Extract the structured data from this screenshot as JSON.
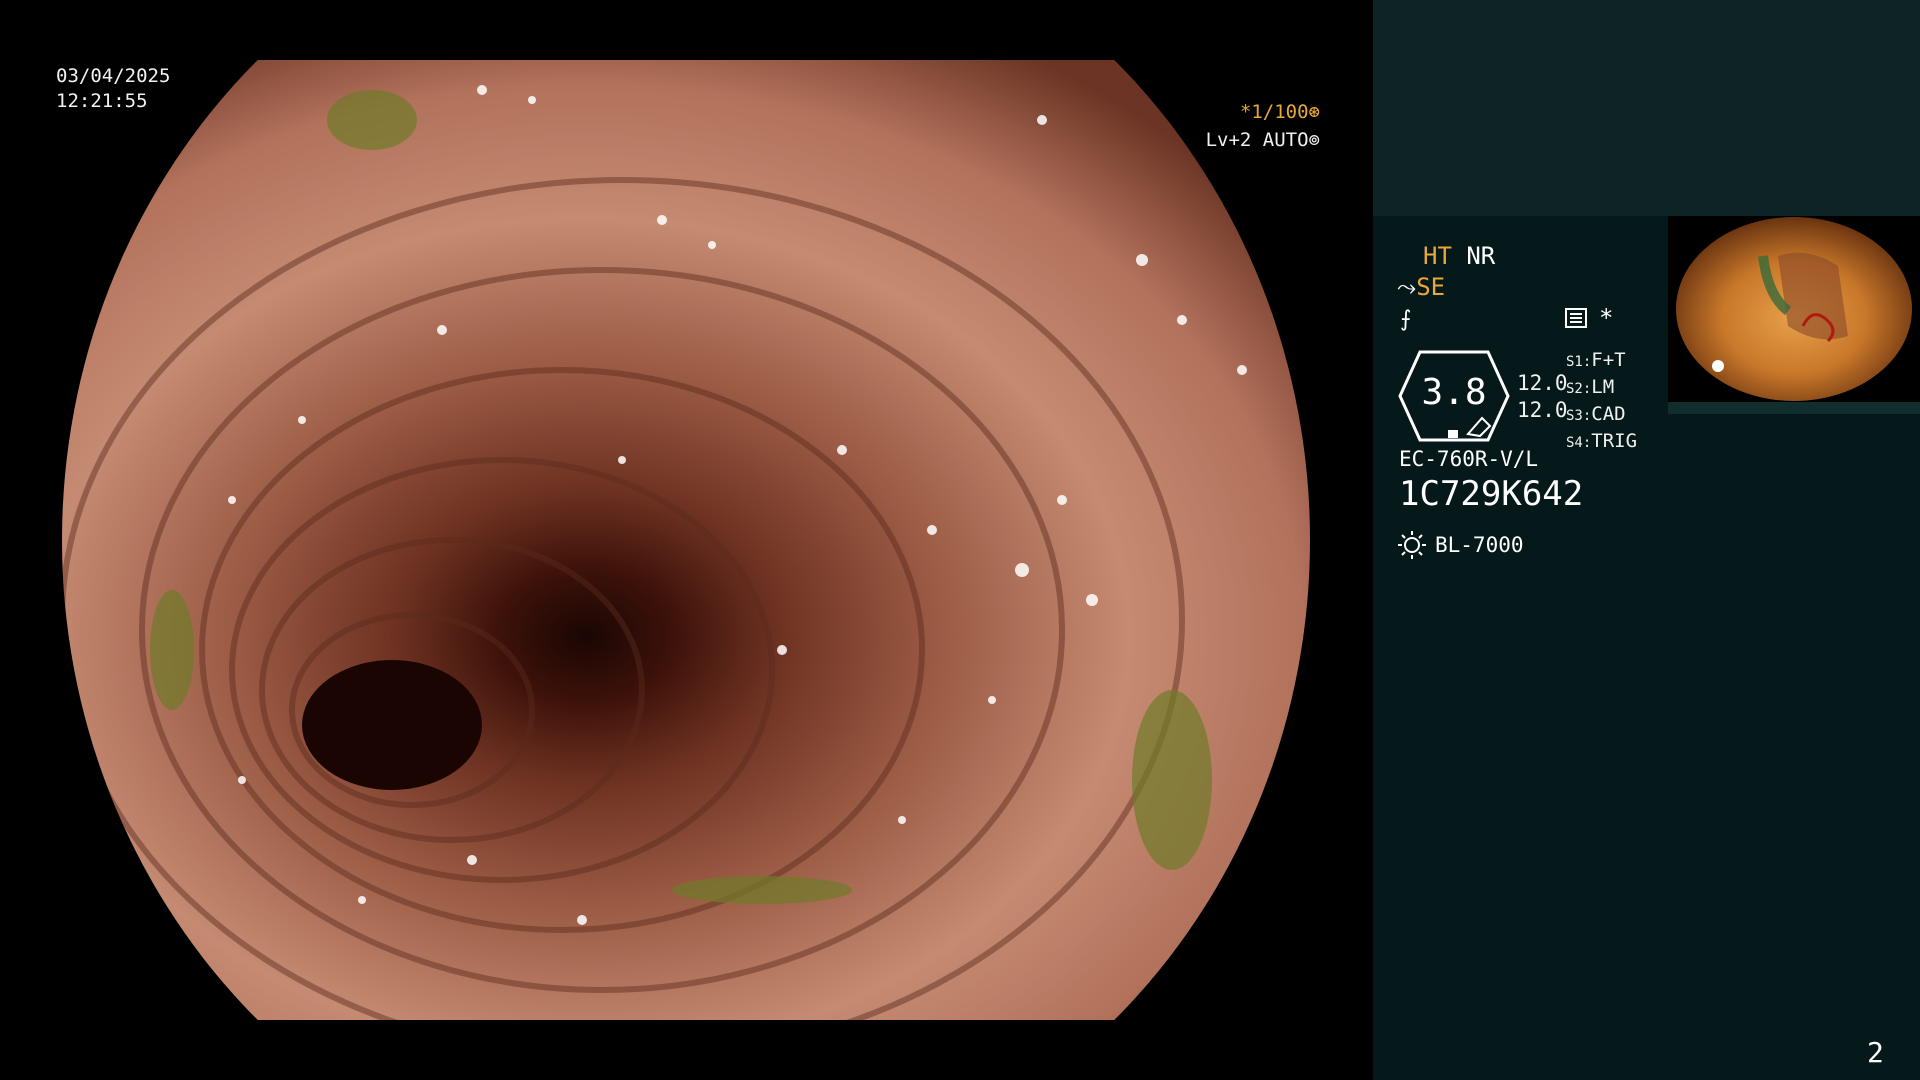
{
  "screen": {
    "date": "03/04/2025",
    "time": "12:21:55",
    "shutter_speed": "*1/100",
    "shutter_speed_icon": "aperture-icon",
    "light_level": "Lv+2 AUTO",
    "light_level_icon": "iris-icon",
    "page_number": "2"
  },
  "panel": {
    "ht_label": "HT",
    "nr_label": "NR",
    "se_label": "SE",
    "se_icon": "structure-enhancement-icon",
    "fn_icon": "function-icon",
    "menu_icon": "menu-list-icon",
    "star_mark": "*",
    "zoom_value": "3.8",
    "gain_values": [
      "12.0",
      "12.0"
    ],
    "switches": [
      {
        "key": "S1:",
        "value": "F+T"
      },
      {
        "key": "S2:",
        "value": "LM"
      },
      {
        "key": "S3:",
        "value": "CAD"
      },
      {
        "key": "S4:",
        "value": "TRIG"
      }
    ],
    "scope_model": "EC-760R-V/L",
    "scope_serial": "1C729K642",
    "light_source": "BL-7000",
    "light_source_icon": "sun-icon"
  },
  "colors": {
    "amber_accent": "#e8a83a",
    "panel_bg": "#06191a",
    "panel_top_bg": "#0e2424"
  }
}
